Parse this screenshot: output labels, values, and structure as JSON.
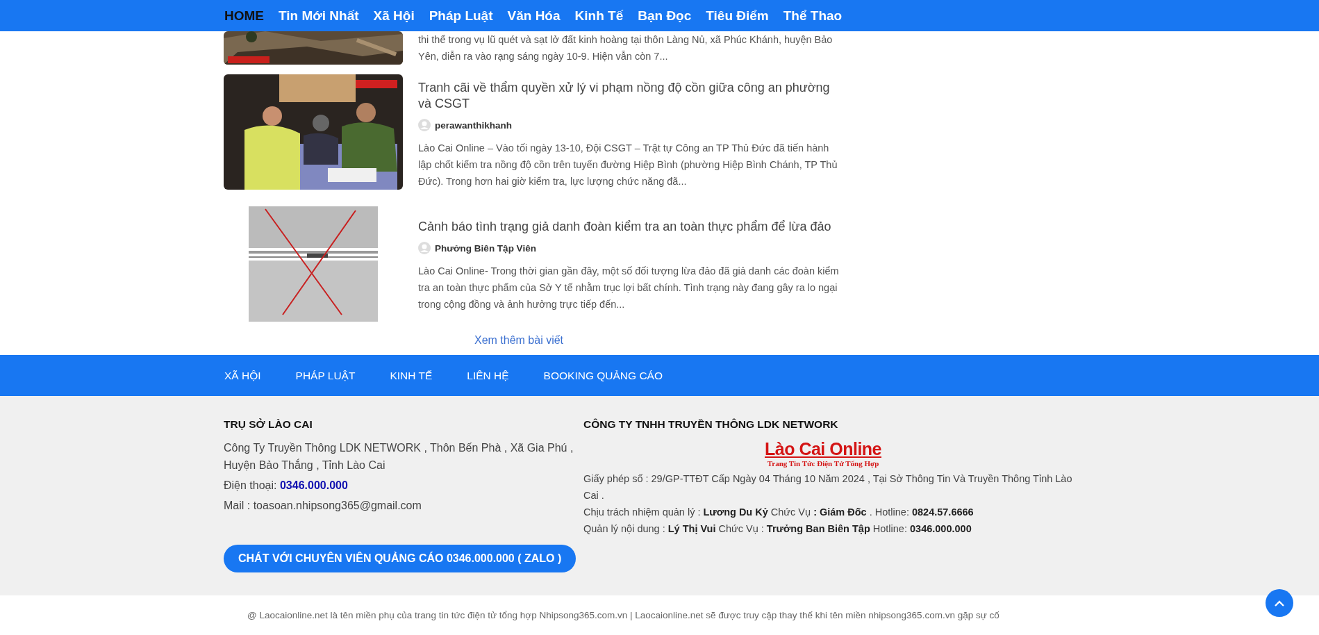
{
  "nav": {
    "items": [
      {
        "label": "HOME",
        "selected": true
      },
      {
        "label": "Tin Mới Nhất",
        "selected": false
      },
      {
        "label": "Xã Hội",
        "selected": false
      },
      {
        "label": "Pháp Luật",
        "selected": false
      },
      {
        "label": "Văn Hóa",
        "selected": false
      },
      {
        "label": "Kinh Tế",
        "selected": false
      },
      {
        "label": "Bạn Đọc",
        "selected": false
      },
      {
        "label": "Tiêu Điểm",
        "selected": false
      },
      {
        "label": "Thể Thao",
        "selected": false
      }
    ]
  },
  "articles": [
    {
      "excerpt": "thi thể trong vụ lũ quét và sạt lở đất kinh hoàng tại thôn Làng Nủ, xã Phúc Khánh, huyện Bảo Yên, diễn ra vào rạng sáng ngày 10-9. Hiện vẫn còn 7..."
    },
    {
      "title": "Tranh cãi về thẩm quyền xử lý vi phạm nồng độ cồn giữa công an phường và CSGT",
      "author": "perawanthikhanh",
      "excerpt": "Lào Cai Online – Vào tối ngày 13-10, Đội CSGT – Trật tự Công an TP Thủ Đức đã tiến hành lập chốt kiểm tra nồng độ cồn trên tuyến đường Hiệp Bình (phường Hiệp Bình Chánh, TP Thủ Đức). Trong hơn hai giờ kiểm tra, lực lượng chức năng đã..."
    },
    {
      "title": "Cảnh báo tình trạng giả danh đoàn kiểm tra an toàn thực phẩm để lừa đảo",
      "author": "Phưởng Biên Tập Viên",
      "excerpt": "Lào Cai Online- Trong thời gian gần đây, một số đối tượng lừa đảo đã giả danh các đoàn kiểm tra an toàn thực phẩm của Sở Y tế nhằm trục lợi bất chính. Tình trạng này đang gây ra lo ngại trong cộng đồng và ảnh hưởng trực tiếp đến..."
    }
  ],
  "more_link": "Xem thêm bài viết",
  "footer_nav": [
    "XÃ HỘI",
    "PHÁP LUẬT",
    "KINH TẾ",
    "LIÊN HỆ",
    "BOOKING QUẢNG CÁO"
  ],
  "footer": {
    "left": {
      "heading": "TRỤ SỞ LÀO CAI",
      "address": "Công Ty Truyền Thông LDK NETWORK , Thôn Bến Phà , Xã Gia Phú , Huyện Bảo Thắng , Tỉnh Lào Cai",
      "phone_label": "Điện thoại:",
      "phone": "0346.000.000",
      "mail": "Mail : toasoan.nhipsong365@gmail.com",
      "cta": "CHÁT VỚI CHUYÊN VIÊN QUẢNG CÁO 0346.000.000 ( ZALO )"
    },
    "right": {
      "heading": "CÔNG TY TNHH TRUYỀN THÔNG LDK NETWORK",
      "logo_title": "Lào Cai Online",
      "logo_tagline": "Trang Tin Tức Điện Tử Tổng Hợp",
      "lines": [
        "Giấy phép số : 29/GP-TTĐT Cấp Ngày 04 Tháng 10 Năm 2024 , Tại Sở Thông Tin Và Truyền Thông Tỉnh Lào Cai .",
        "Chịu trách nhiệm quản lý : **Lương Du Kỷ**  Chức Vụ **: Giám Đốc** . Hotline: **0824.57.6666**",
        "Quản lý nội dung : **Lý Thị Vui**  Chức Vụ : **Trưởng Ban Biên Tập**  Hotline: **0346.000.000**"
      ]
    }
  },
  "copyright": "@ Laocaionline.net là tên miền phụ của trang tin tức điện tử tổng hợp Nhipsong365.com.vn | Laocaionline.net sẽ được truy cập thay thế khi tên miền nhipsong365.com.vn gặp sự cố"
}
